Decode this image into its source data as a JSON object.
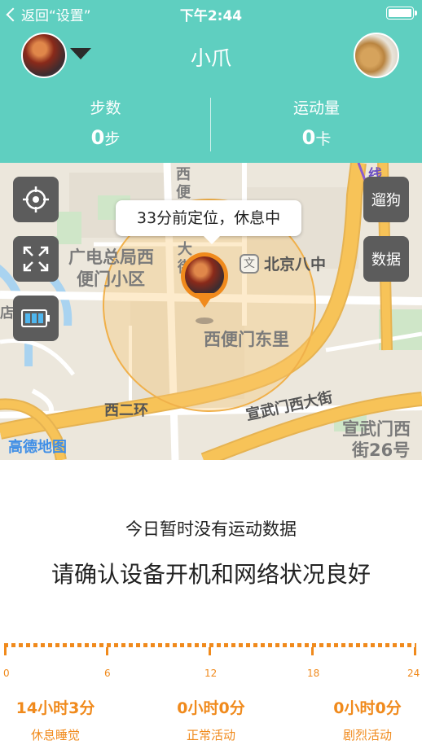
{
  "status_bar": {
    "back_label": "返回“设置”",
    "time": "下午2:44"
  },
  "header": {
    "title": "小爪",
    "stats": [
      {
        "label": "步数",
        "value": "0",
        "unit": "步"
      },
      {
        "label": "运动量",
        "value": "0",
        "unit": "卡"
      }
    ]
  },
  "map": {
    "location_bubble": "33分前定位，休息中",
    "controls_left": [
      "locate-icon",
      "fullscreen-icon",
      "battery-icon"
    ],
    "controls_right": [
      "遛狗",
      "数据"
    ],
    "labels": {
      "area_1_line1": "广电总局西",
      "area_1_line2": "便门小区",
      "poi": "北京八中",
      "poi_icon": "文",
      "area_2": "西便门东里",
      "road_1": "西二环",
      "road_2": "宣武门西大街",
      "area_3_line1": "宣武门西",
      "area_3_line2": "街26号",
      "vertical_1": "西便",
      "vertical_2": "大街",
      "left_edge": "店",
      "line_label": "线"
    },
    "provider": "高德地图"
  },
  "activity": {
    "no_data": "今日暂时没有运动数据",
    "confirm": "请确认设备开机和网络状况良好",
    "hours": [
      "0",
      "6",
      "12",
      "18",
      "24"
    ],
    "summary": [
      {
        "duration": "14小时3分",
        "category": "休息睡觉"
      },
      {
        "duration": "0小时0分",
        "category": "正常活动"
      },
      {
        "duration": "0小时0分",
        "category": "剧烈活动"
      }
    ]
  },
  "colors": {
    "header_bg": "#5fcfc0",
    "accent": "#f08a1c",
    "road": "#f7c358"
  }
}
